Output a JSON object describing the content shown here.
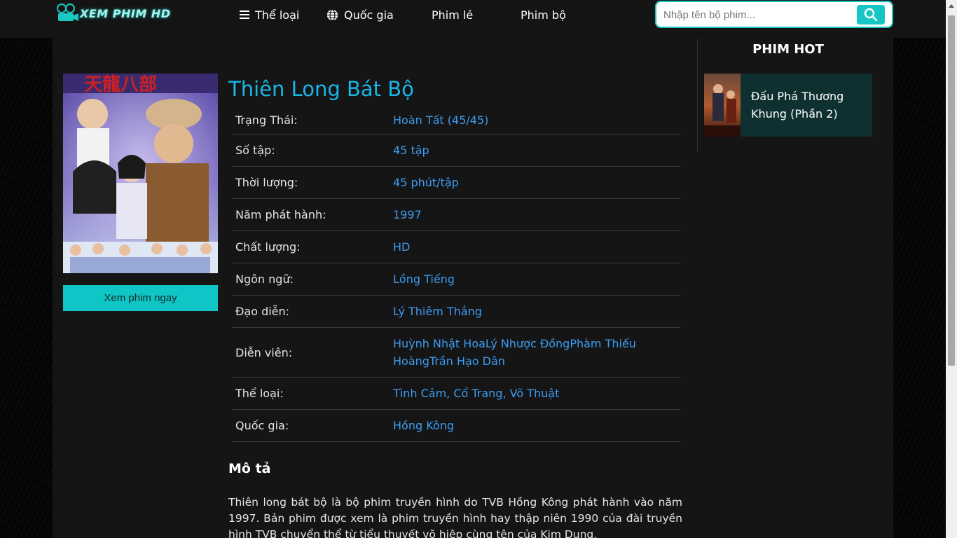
{
  "header": {
    "logo_text": "XEM PHIM HD",
    "nav": [
      {
        "label": "Thể loại",
        "icon": "menu-icon"
      },
      {
        "label": "Quốc gia",
        "icon": "globe-icon"
      },
      {
        "label": "Phim lẻ"
      },
      {
        "label": "Phim bộ"
      }
    ],
    "search": {
      "placeholder": "Nhập tên bộ phim...",
      "value": "",
      "icon": "search-icon"
    }
  },
  "movie": {
    "title": "Thiên Long Bát Bộ",
    "watch_button": "Xem phim ngay",
    "info": [
      {
        "label": "Trạng Thái:",
        "value": "Hoàn Tất (45/45)"
      },
      {
        "label": "Số tập:",
        "value": "45 tập"
      },
      {
        "label": "Thời lượng:",
        "value": "45 phút/tập"
      },
      {
        "label": "Năm phát hành:",
        "value": "1997"
      },
      {
        "label": "Chất lượng:",
        "value": "HD"
      },
      {
        "label": "Ngôn ngữ:",
        "value": "Lồng Tiếng"
      },
      {
        "label": "Đạo diễn:",
        "value": "Lý Thiêm Thắng"
      },
      {
        "label": "Diễn viên:",
        "value": "Huỳnh Nhật HoaLý Nhược ĐồngPhàm Thiếu HoàngTrần Hạo Dân"
      },
      {
        "label": "Thể loại:",
        "value": "Tình Cảm, Cổ Trang, Võ Thuật"
      },
      {
        "label": "Quốc gia:",
        "value": "Hồng Kông"
      }
    ],
    "description_heading": "Mô tả",
    "description": "Thiên long bát bộ là bộ phim truyền hình do TVB Hồng Kông phát hành vào năm 1997. Bản phim được xem là phim truyền hình hay thập niên 1990 của đài truyền hình TVB chuyển thể từ tiểu thuyết võ hiệp cùng tên của Kim Dung."
  },
  "sidebar": {
    "heading": "PHIM HOT",
    "items": [
      {
        "title": "Đấu Phá Thương Khung (Phần 2)"
      }
    ]
  },
  "colors": {
    "accent": "#10c5c5",
    "title": "#19b6e6",
    "link": "#3d9cf0",
    "panel": "#151515",
    "hot_item_bg": "#0e3030"
  }
}
